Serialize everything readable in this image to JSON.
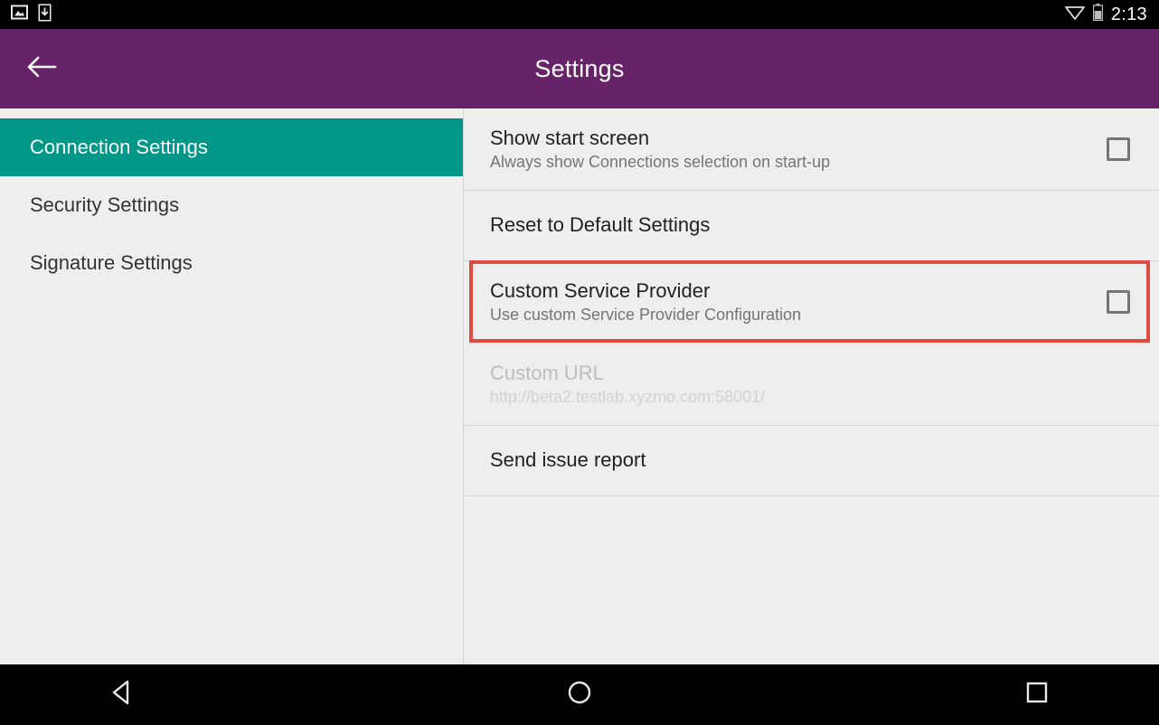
{
  "status_bar": {
    "time": "2:13",
    "left_icons": [
      "image-icon",
      "download-icon"
    ],
    "right_icons": [
      "wifi-icon",
      "battery-icon"
    ]
  },
  "app_bar": {
    "title": "Settings",
    "back_icon": "arrow-left-icon",
    "background_color": "#672368",
    "text_color": "#ffffff"
  },
  "sidebar": {
    "selected_index": 0,
    "selected_color": "#009688",
    "items": [
      {
        "label": "Connection Settings",
        "selected": true
      },
      {
        "label": "Security Settings",
        "selected": false
      },
      {
        "label": "Signature Settings",
        "selected": false
      }
    ]
  },
  "settings_rows": [
    {
      "title": "Show start screen",
      "subtitle": "Always show Connections selection on start-up",
      "control": "checkbox",
      "checked": false,
      "enabled": true,
      "highlighted": false
    },
    {
      "title": "Reset to Default Settings",
      "subtitle": "",
      "control": "none",
      "checked": false,
      "enabled": true,
      "highlighted": false
    },
    {
      "title": "Custom Service Provider",
      "subtitle": "Use custom Service Provider Configuration",
      "control": "checkbox",
      "checked": false,
      "enabled": true,
      "highlighted": true
    },
    {
      "title": "Custom URL",
      "subtitle": "http://beta2.testlab.xyzmo.com:58001/",
      "control": "none",
      "checked": false,
      "enabled": false,
      "highlighted": false
    },
    {
      "title": "Send issue report",
      "subtitle": "",
      "control": "none",
      "checked": false,
      "enabled": true,
      "highlighted": false
    }
  ],
  "highlight": {
    "color": "#e04b42",
    "target": "Custom Service Provider"
  },
  "nav_bar": {
    "buttons": [
      {
        "name": "back-nav-icon"
      },
      {
        "name": "home-nav-icon"
      },
      {
        "name": "recents-nav-icon"
      }
    ]
  }
}
